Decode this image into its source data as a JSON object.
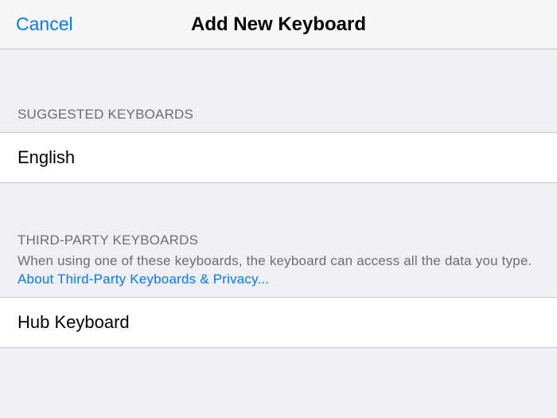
{
  "navbar": {
    "cancel_label": "Cancel",
    "title": "Add New Keyboard"
  },
  "sections": {
    "suggested": {
      "header": "Suggested Keyboards",
      "items": [
        {
          "label": "English"
        }
      ]
    },
    "thirdparty": {
      "header": "Third-Party Keyboards",
      "description": "When using one of these keyboards, the keyboard can access all the data you type. ",
      "privacy_link": "About Third-Party Keyboards & Privacy...",
      "items": [
        {
          "label": "Hub Keyboard"
        }
      ]
    }
  },
  "colors": {
    "accent": "#007aff",
    "background": "#efeff4",
    "header_text": "#6d6d72",
    "border": "#c7c7cb"
  }
}
